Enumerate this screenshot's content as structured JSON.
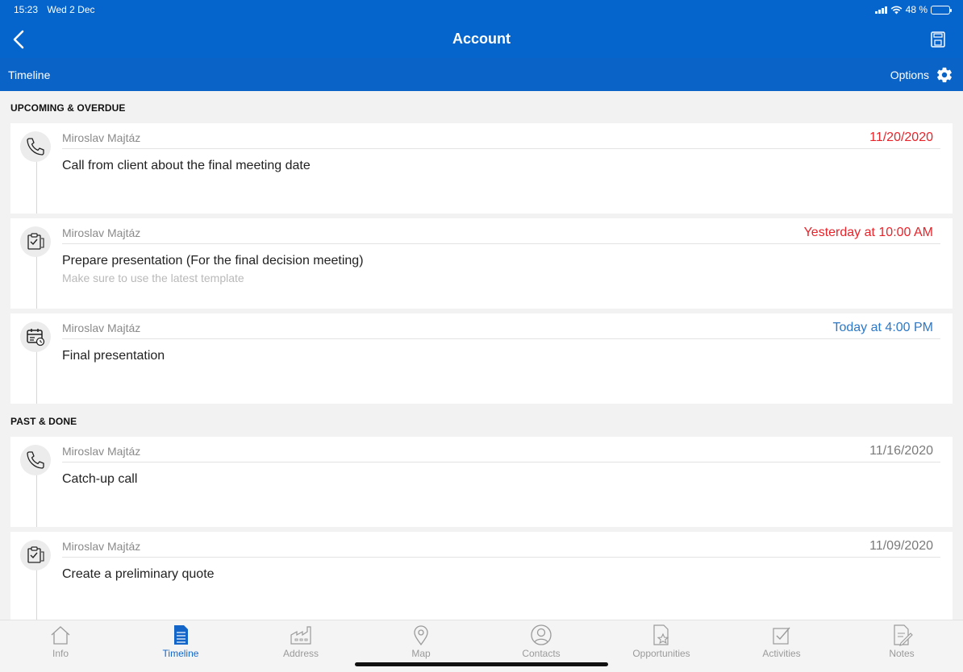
{
  "status_bar": {
    "time": "15:23",
    "date": "Wed 2 Dec",
    "battery": "48 %",
    "battery_level": 0.48
  },
  "header": {
    "title": "Account",
    "subtitle": "Timeline",
    "options_label": "Options"
  },
  "sections": [
    {
      "heading": "UPCOMING & OVERDUE",
      "items": [
        {
          "icon": "phone-icon",
          "owner": "Miroslav Majtáz",
          "date": "11/20/2020",
          "date_color": "#e8232a",
          "subject": "Call from client about the final meeting date",
          "description": ""
        },
        {
          "icon": "task-icon",
          "owner": "Miroslav Majtáz",
          "date": "Yesterday at 10:00 AM",
          "date_color": "#e8232a",
          "subject": "Prepare presentation (For the final decision meeting)",
          "description": "Make sure to use the latest template"
        },
        {
          "icon": "calendar-icon",
          "owner": "Miroslav Majtáz",
          "date": "Today at 4:00 PM",
          "date_color": "#2d78c7",
          "subject": "Final presentation",
          "description": ""
        }
      ]
    },
    {
      "heading": "PAST & DONE",
      "items": [
        {
          "icon": "phone-icon",
          "owner": "Miroslav Majtáz",
          "date": "11/16/2020",
          "date_color": "#7a7a7a",
          "subject": "Catch-up call",
          "description": ""
        },
        {
          "icon": "task-icon",
          "owner": "Miroslav Majtáz",
          "date": "11/09/2020",
          "date_color": "#7a7a7a",
          "subject": "Create a preliminary quote",
          "description": ""
        }
      ]
    }
  ],
  "tabs": [
    {
      "label": "Info",
      "icon": "home-icon",
      "active": false
    },
    {
      "label": "Timeline",
      "icon": "timeline-icon",
      "active": true
    },
    {
      "label": "Address",
      "icon": "factory-icon",
      "active": false
    },
    {
      "label": "Map",
      "icon": "map-pin-icon",
      "active": false
    },
    {
      "label": "Contacts",
      "icon": "contacts-icon",
      "active": false
    },
    {
      "label": "Opportunities",
      "icon": "opportunity-icon",
      "active": false
    },
    {
      "label": "Activities",
      "icon": "activities-icon",
      "active": false
    },
    {
      "label": "Notes",
      "icon": "notes-icon",
      "active": false
    }
  ],
  "colors": {
    "brand": "#0665cc",
    "overdue": "#e8232a",
    "today": "#2d78c7",
    "past": "#7a7a7a"
  }
}
